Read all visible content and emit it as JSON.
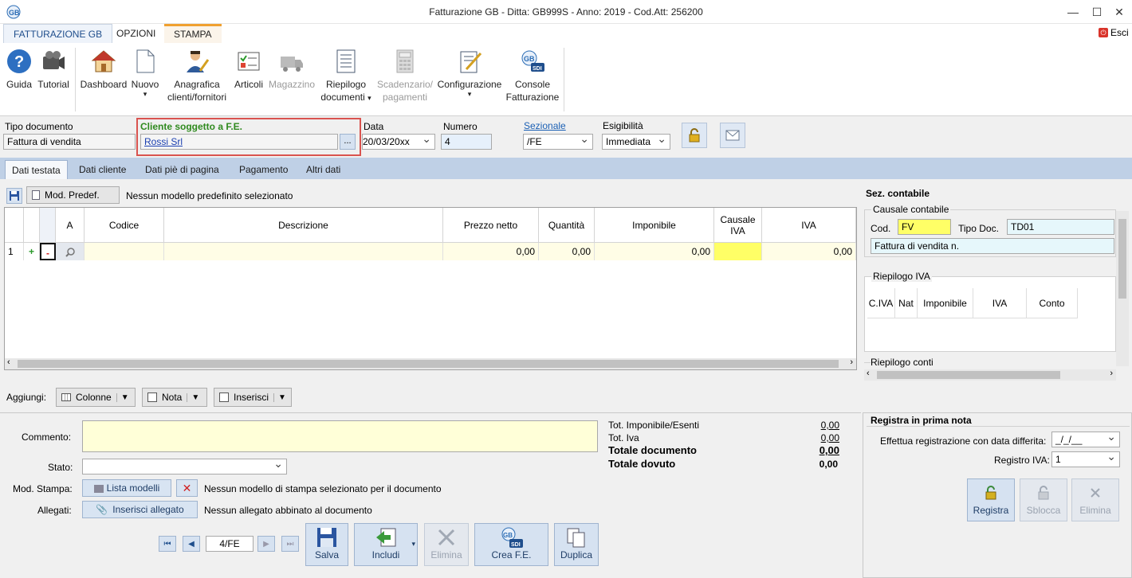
{
  "window": {
    "title": "Fatturazione GB - Ditta: GB999S - Anno: 2019 - Cod.Att: 256200",
    "exit_label": "Esci"
  },
  "ribbon_tabs": [
    "FATTURAZIONE GB",
    "OPZIONI",
    "STAMPA"
  ],
  "ribbon": {
    "guida": "Guida",
    "tutorial": "Tutorial",
    "dashboard": "Dashboard",
    "nuovo": "Nuovo",
    "anagrafica_1": "Anagrafica",
    "anagrafica_2": "clienti/fornitori",
    "articoli": "Articoli",
    "magazzino": "Magazzino",
    "riepilogo_1": "Riepilogo",
    "riepilogo_2": "documenti",
    "scadenzario_1": "Scadenzario/",
    "scadenzario_2": "pagamenti",
    "configurazione": "Configurazione",
    "console_1": "Console",
    "console_2": "Fatturazione"
  },
  "header": {
    "tipo_label": "Tipo documento",
    "tipo_value": "Fattura di vendita",
    "cliente_label": "Cliente soggetto a F.E.",
    "cliente_value": "Rossi Srl",
    "cliente_btn": "...",
    "data_label": "Data",
    "data_value": "20/03/20xx",
    "numero_label": "Numero",
    "numero_value": "4",
    "sezionale_label": "Sezionale",
    "sezionale_value": "/FE",
    "esigibilita_label": "Esigibilità",
    "esigibilita_value": "Immediata"
  },
  "doc_tabs": [
    "Dati testata",
    "Dati cliente",
    "Dati piè di pagina",
    "Pagamento",
    "Altri dati"
  ],
  "model": {
    "button": "Mod. Predef.",
    "text": "Nessun modello predefinito selezionato"
  },
  "grid": {
    "columns": [
      "A",
      "Codice",
      "Descrizione",
      "Prezzo netto",
      "Quantità",
      "Imponibile",
      "Causale IVA",
      "IVA"
    ],
    "row": {
      "num": "1",
      "add": "+",
      "del": "-",
      "codice": "",
      "descrizione": "",
      "prezzo": "0,00",
      "quantita": "0,00",
      "imponibile": "0,00",
      "causale": "",
      "iva": "0,00"
    }
  },
  "sez_contabile": {
    "title": "Sez. contabile",
    "causale_title": "Causale contabile",
    "cod_label": "Cod.",
    "cod_value": "FV",
    "tipodoc_label": "Tipo Doc.",
    "tipodoc_value": "TD01",
    "desc_value": "Fattura di vendita n.",
    "riepilogo_iva_title": "Riepilogo IVA",
    "iva_cols": [
      "C.IVA",
      "Nat",
      "Imponibile",
      "IVA",
      "Conto"
    ],
    "riepilogo_conti_title": "Riepilogo conti"
  },
  "toolbar": {
    "aggiungi": "Aggiungi:",
    "colonne": "Colonne",
    "nota": "Nota",
    "inserisci": "Inserisci"
  },
  "footer": {
    "commento_label": "Commento:",
    "stato_label": "Stato:",
    "modstampa_label": "Mod. Stampa:",
    "lista_modelli": "Lista modelli",
    "modstampa_text": "Nessun modello di stampa selezionato per il documento",
    "allegati_label": "Allegati:",
    "inserisci_allegato": "Inserisci allegato",
    "allegati_text": "Nessun allegato abbinato al documento",
    "nav_value": "4/FE",
    "salva": "Salva",
    "includi": "Includi",
    "elimina": "Elimina",
    "crea_fe": "Crea F.E.",
    "duplica": "Duplica"
  },
  "totals": {
    "imponibile_label": "Tot. Imponibile/Esenti",
    "imponibile_value": "0,00",
    "iva_label": "Tot. Iva",
    "iva_value": "0,00",
    "documento_label": "Totale documento",
    "documento_value": "0,00",
    "dovuto_label": "Totale dovuto",
    "dovuto_value": "0,00"
  },
  "registra": {
    "title": "Registra in prima nota",
    "differita_label": "Effettua registrazione con data differita:",
    "differita_value": "_/_/__",
    "registro_label": "Registro IVA:",
    "registro_value": "1",
    "registra_btn": "Registra",
    "sblocca_btn": "Sblocca",
    "elimina_btn": "Elimina"
  },
  "colors": {
    "accent": "#1f4e8c",
    "highlight_border": "#d9534f",
    "yellow": "#ffff66",
    "green_label": "#2f8a1f"
  }
}
